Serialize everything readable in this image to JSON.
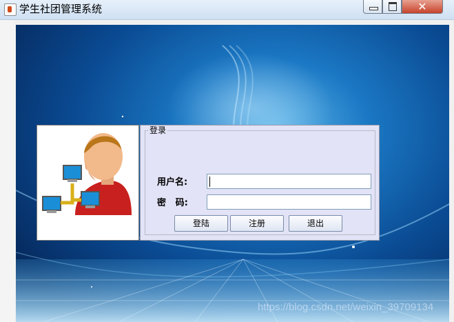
{
  "window": {
    "title": "学生社团管理系统",
    "controls": {
      "minimize": "minimize",
      "maximize": "maximize",
      "close": "close"
    },
    "close_glyph": "✕"
  },
  "login": {
    "group_title": "登录",
    "username_label": "用户名:",
    "username_value": "",
    "password_label": "密   码:",
    "password_value": "",
    "buttons": {
      "login": "登陆",
      "register": "注册",
      "exit": "退出"
    }
  },
  "watermark": "https://blog.csdn.net/weixin_39709134",
  "colors": {
    "panel_bg": "#e2e3f6",
    "background_blue": "#0a4a92",
    "close_red": "#c7442c"
  },
  "icons": {
    "app": "java-cup-icon",
    "user": "user-network-icon"
  }
}
